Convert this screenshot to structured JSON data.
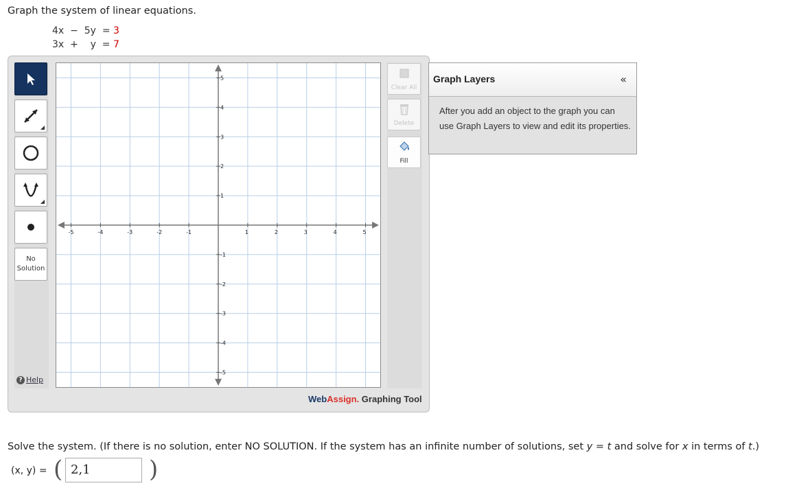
{
  "question": "Graph the system of linear equations.",
  "equations": [
    {
      "lhs": "4x  −  5y  =",
      "rhs": "3"
    },
    {
      "lhs": "3x  +    y  =",
      "rhs": "7"
    }
  ],
  "toolbar": {
    "no_solution_line1": "No",
    "no_solution_line2": "Solution",
    "help": "Help"
  },
  "graph": {
    "x_ticks": [
      "-5",
      "-4",
      "-3",
      "-2",
      "-1",
      "1",
      "2",
      "3",
      "4",
      "5"
    ],
    "y_ticks": [
      "5",
      "4",
      "3",
      "2",
      "1",
      "-1",
      "-2",
      "-3",
      "-4",
      "-5"
    ]
  },
  "right_tools": {
    "clear_all": "Clear All",
    "delete": "Delete",
    "fill": "Fill"
  },
  "brand": {
    "part1": "Web",
    "part2": "Assign.",
    "part3": " Graphing Tool"
  },
  "layers": {
    "title": "Graph Layers",
    "collapse": "«",
    "body": "After you add an object to the graph you can use Graph Layers to view and edit its properties."
  },
  "prompt": {
    "p1": "Solve the system. (If there is no solution, enter NO SOLUTION. If the system has an infinite number of solutions, set ",
    "p2": "y",
    "p3": " = ",
    "p4": "t",
    "p5": "  and solve for ",
    "p6": "x",
    "p7": " in terms of ",
    "p8": "t",
    "p9": ".)"
  },
  "answer": {
    "label": "(x, y) =",
    "value": "2,1"
  },
  "colors": {
    "active_tool": "#15335e",
    "brand_blue": "#1b3a66",
    "brand_red": "#d9302a",
    "grid": "#b8cfe6"
  }
}
